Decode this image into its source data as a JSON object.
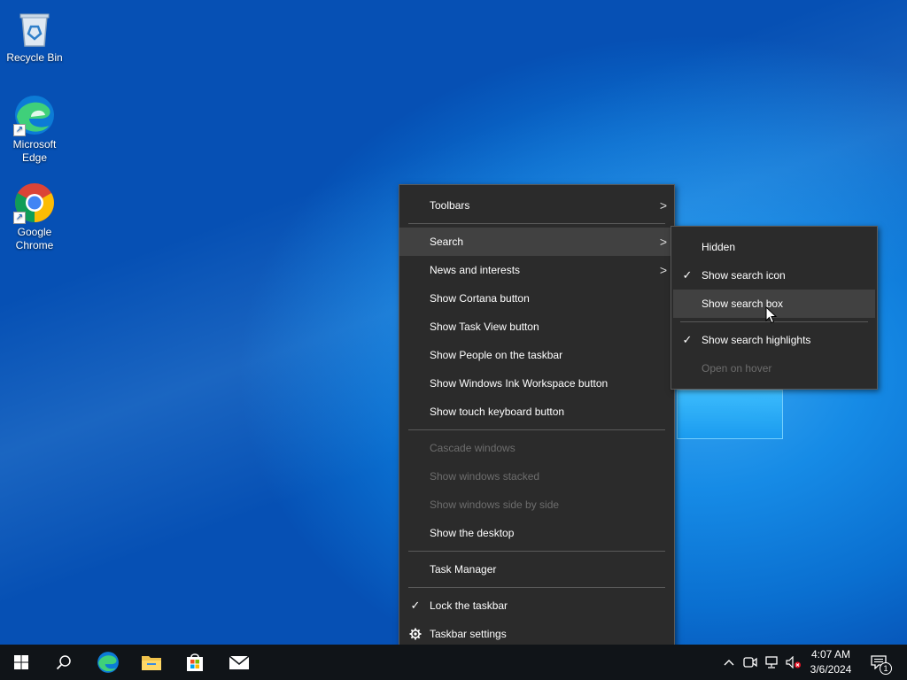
{
  "desktop": {
    "icons": [
      {
        "label": "Recycle Bin",
        "icon": "recycle-bin-icon"
      },
      {
        "label": "Microsoft Edge",
        "icon": "edge-icon"
      },
      {
        "label": "Google Chrome",
        "icon": "chrome-icon"
      }
    ]
  },
  "context_menu": {
    "items": [
      {
        "label": "Toolbars",
        "submenu": true
      },
      {
        "label": "Search",
        "submenu": true,
        "highlighted": true
      },
      {
        "label": "News and interests",
        "submenu": true
      },
      {
        "label": "Show Cortana button"
      },
      {
        "label": "Show Task View button"
      },
      {
        "label": "Show People on the taskbar"
      },
      {
        "label": "Show Windows Ink Workspace button"
      },
      {
        "label": "Show touch keyboard button"
      },
      {
        "label": "Cascade windows",
        "disabled": true
      },
      {
        "label": "Show windows stacked",
        "disabled": true
      },
      {
        "label": "Show windows side by side",
        "disabled": true
      },
      {
        "label": "Show the desktop"
      },
      {
        "label": "Task Manager"
      },
      {
        "label": "Lock the taskbar",
        "checked": true
      },
      {
        "label": "Taskbar settings",
        "icon": "gear-icon"
      }
    ]
  },
  "search_submenu": {
    "items": [
      {
        "label": "Hidden"
      },
      {
        "label": "Show search icon",
        "checked": true
      },
      {
        "label": "Show search box",
        "highlighted": true
      },
      {
        "label": "Show search highlights",
        "checked": true
      },
      {
        "label": "Open on hover",
        "disabled": true
      }
    ]
  },
  "taskbar": {
    "clock": {
      "time": "4:07 AM",
      "date": "3/6/2024"
    },
    "notification_count": "1",
    "pinned": [
      "start-icon",
      "search-icon",
      "edge-icon",
      "file-explorer-icon",
      "store-icon",
      "mail-icon"
    ],
    "tray": [
      "chevron-up-icon",
      "meet-now-icon",
      "network-icon",
      "volume-muted-icon",
      "notification-icon"
    ]
  },
  "colors": {
    "menu_bg": "#2b2b2b",
    "menu_hover": "#414141",
    "disabled_text": "#6d6d6d",
    "taskbar_bg": "#101418",
    "desktop_blue": "#0a6fd0"
  }
}
